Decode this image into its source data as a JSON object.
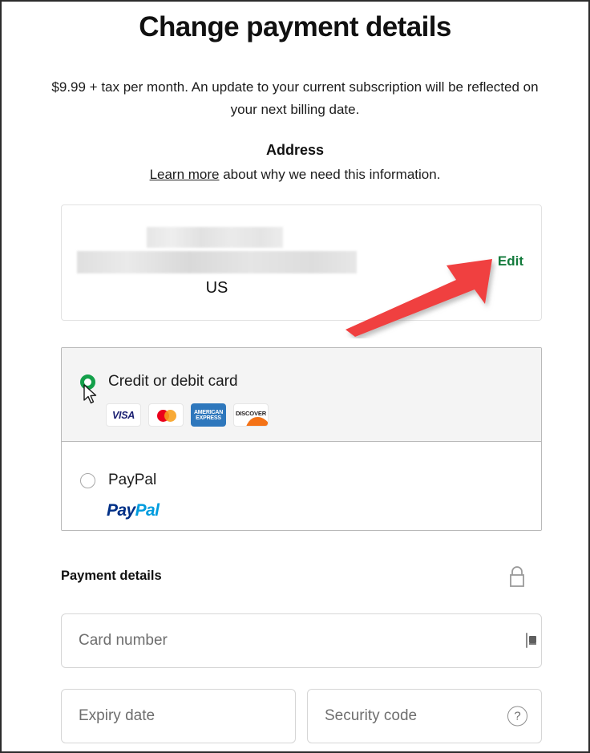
{
  "page": {
    "title": "Change payment details",
    "subtitle": "$9.99 + tax per month. An update to your current subscription will be reflected on your next billing date."
  },
  "address": {
    "heading": "Address",
    "learn_more_link": "Learn more",
    "learn_more_rest": " about why we need this information.",
    "country": "US",
    "edit_label": "Edit",
    "redacted_lines": [
      "",
      ""
    ]
  },
  "payment_methods": {
    "options": [
      {
        "label": "Credit or debit card",
        "selected": true,
        "brands": [
          {
            "name": "visa-logo",
            "text": "VISA"
          },
          {
            "name": "mastercard-logo",
            "text": ""
          },
          {
            "name": "amex-logo",
            "line1": "AMERICAN",
            "line2": "EXPRESS"
          },
          {
            "name": "discover-logo",
            "text": "DISCOVER"
          }
        ]
      },
      {
        "label": "PayPal",
        "selected": false,
        "logo": {
          "part1": "Pay",
          "part2": "Pal"
        }
      }
    ]
  },
  "payment_details": {
    "heading": "Payment details",
    "lock_icon": "lock-icon",
    "fields": [
      {
        "name": "card-number",
        "placeholder": "Card number",
        "value": "",
        "icon": "scan-card-icon"
      },
      {
        "name": "expiry-date",
        "placeholder": "Expiry date",
        "value": "",
        "icon": ""
      },
      {
        "name": "security-code",
        "placeholder": "Security code",
        "value": "",
        "icon": "help-circle-icon",
        "icon_glyph": "?"
      }
    ]
  },
  "annotations": {
    "arrow": {
      "name": "red-arrow-annotation",
      "points_to": "Edit",
      "color": "#f04040"
    },
    "cursor": {
      "name": "mouse-cursor",
      "at": "credit-or-debit-card-radio"
    }
  },
  "colors": {
    "accent_green": "#137a3c",
    "radio_green": "#13a04a",
    "arrow_red": "#f04040",
    "selected_row_bg": "#f4f4f4",
    "border": "#b9b9b9"
  }
}
